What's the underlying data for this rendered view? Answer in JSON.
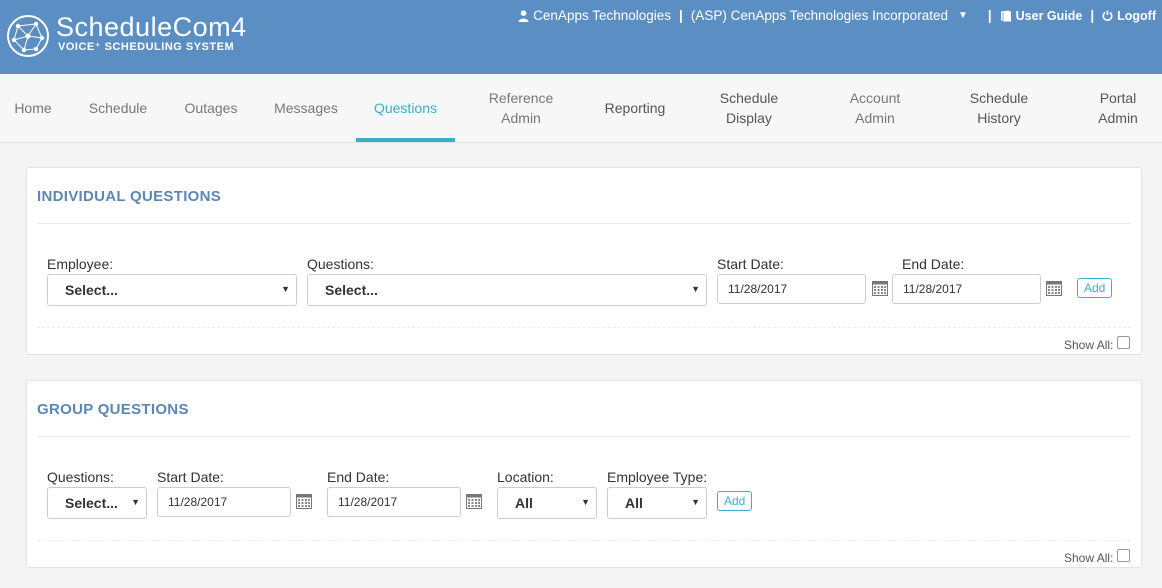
{
  "brand": {
    "title": "ScheduleCom4",
    "subtitle": "VOICE⁺ SCHEDULING SYSTEM"
  },
  "topbar": {
    "company": "CenApps Technologies",
    "account": "(ASP) CenApps Technologies Incorporated",
    "user_guide": "User Guide",
    "logoff": "Logoff"
  },
  "nav": {
    "items": [
      {
        "label": "Home"
      },
      {
        "label": "Schedule"
      },
      {
        "label": "Outages"
      },
      {
        "label": "Messages"
      },
      {
        "label": "Questions"
      },
      {
        "label": "Reference\nAdmin"
      },
      {
        "label": "Reporting"
      },
      {
        "label": "Schedule\nDisplay"
      },
      {
        "label": "Account\nAdmin"
      },
      {
        "label": "Schedule\nHistory"
      },
      {
        "label": "Portal\nAdmin"
      }
    ],
    "active": "Questions"
  },
  "individual": {
    "title": "INDIVIDUAL QUESTIONS",
    "employee_label": "Employee:",
    "employee_value": "Select...",
    "questions_label": "Questions:",
    "questions_value": "Select...",
    "start_label": "Start Date:",
    "start_value": "11/28/2017",
    "end_label": "End Date:",
    "end_value": "11/28/2017",
    "add_label": "Add",
    "show_all": "Show All:"
  },
  "group": {
    "title": "GROUP QUESTIONS",
    "questions_label": "Questions:",
    "questions_value": "Select...",
    "start_label": "Start Date:",
    "start_value": "11/28/2017",
    "end_label": "End Date:",
    "end_value": "11/28/2017",
    "location_label": "Location:",
    "location_value": "All",
    "emptype_label": "Employee Type:",
    "emptype_value": "All",
    "add_label": "Add",
    "show_all": "Show All:"
  },
  "icons": {
    "user": "user-icon",
    "book": "book-icon",
    "power": "power-icon",
    "calendar": "calendar-icon",
    "caret": "chevron-down-icon"
  },
  "colors": {
    "header": "#5b8fc4",
    "accent": "#3ab0c8",
    "panel_title": "#5b87b5"
  }
}
